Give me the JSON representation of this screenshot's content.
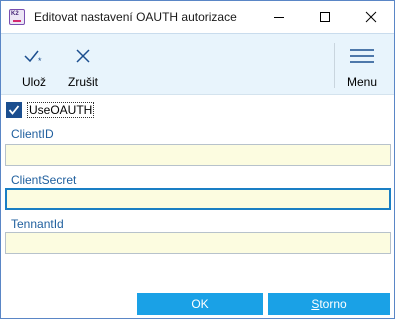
{
  "window": {
    "title": "Editovat nastavení OAUTH autorizace",
    "app_icon_text": "K2"
  },
  "toolbar": {
    "save_label": "Ulož",
    "cancel_label": "Zrušit",
    "menu_label": "Menu"
  },
  "form": {
    "use_oauth_label": "UseOAUTH",
    "use_oauth_checked": true,
    "fields": [
      {
        "label": "ClientID",
        "value": ""
      },
      {
        "label": "ClientSecret",
        "value": ""
      },
      {
        "label": "TennantId",
        "value": ""
      }
    ]
  },
  "footer": {
    "ok_label": "OK",
    "cancel_label": "Storno"
  },
  "colors": {
    "accent": "#1aa1e6",
    "toolbar_bg": "#e8f4fc",
    "field_bg": "#fcfce0",
    "label_blue": "#1f5f9e",
    "checkbox": "#1b4e8f"
  }
}
